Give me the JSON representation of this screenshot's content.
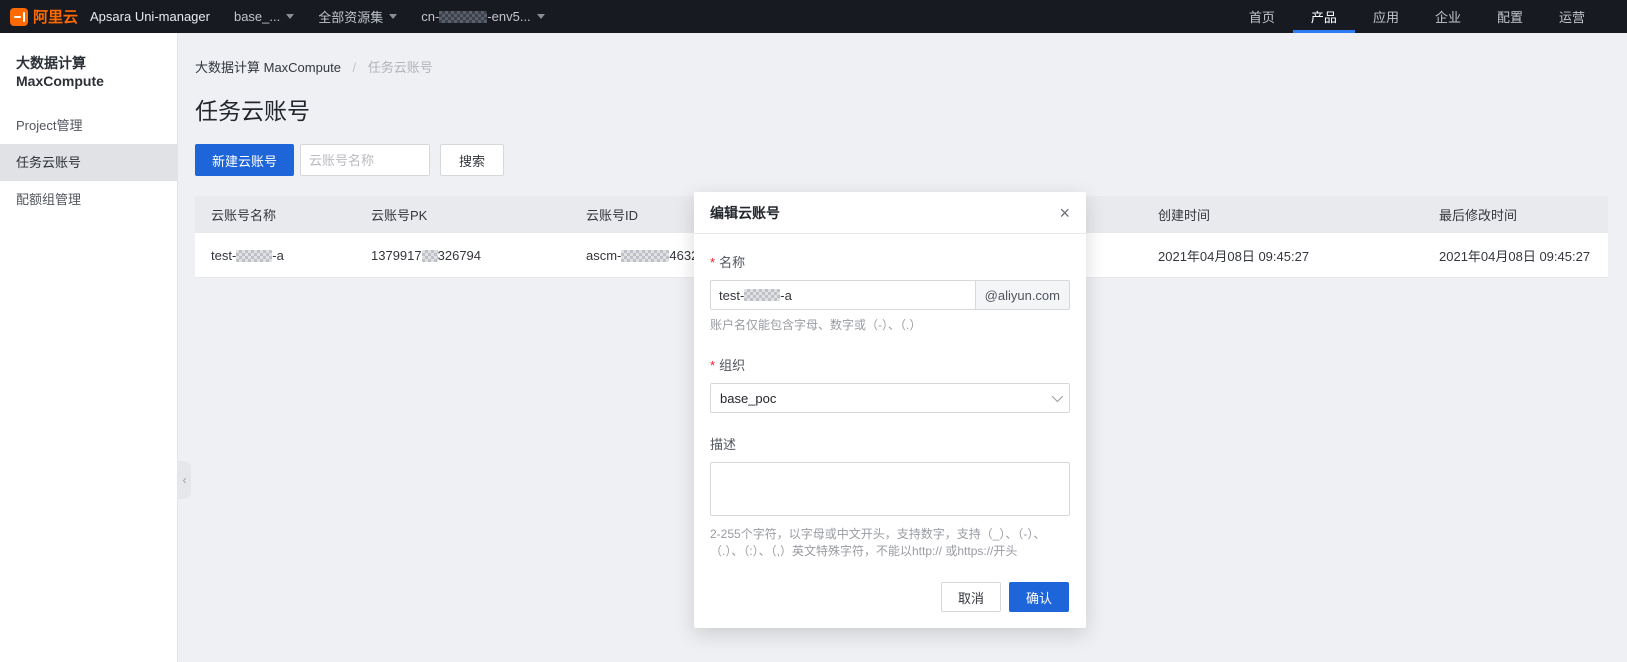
{
  "topbar": {
    "logo_text": "阿里云",
    "product_name": "Apsara Uni-manager",
    "org_dropdown": "base_...",
    "resource_dropdown": "全部资源集",
    "region_prefix": "cn-",
    "region_suffix": "-env5...",
    "menu": [
      {
        "label": "首页"
      },
      {
        "label": "产品"
      },
      {
        "label": "应用"
      },
      {
        "label": "企业"
      },
      {
        "label": "配置"
      },
      {
        "label": "运营"
      }
    ]
  },
  "sidebar": {
    "title": "大数据计算 MaxCompute",
    "items": [
      {
        "label": "Project管理"
      },
      {
        "label": "任务云账号"
      },
      {
        "label": "配额组管理"
      }
    ]
  },
  "breadcrumb": {
    "root": "大数据计算 MaxCompute",
    "separator": "/",
    "current": "任务云账号"
  },
  "page": {
    "title": "任务云账号",
    "new_button": "新建云账号",
    "search_placeholder": "云账号名称",
    "search_button": "搜索"
  },
  "table": {
    "headers": [
      "云账号名称",
      "云账号PK",
      "云账号ID",
      "创建时间",
      "最后修改时间"
    ],
    "row": {
      "name_prefix": "test-",
      "name_suffix": "-a",
      "pk_prefix": "1379917",
      "pk_suffix": "326794",
      "id_prefix": "ascm-",
      "id_mid": "4632",
      "created": "2021年04月08日 09:45:27",
      "modified": "2021年04月08日 09:45:27"
    }
  },
  "modal": {
    "title": "编辑云账号",
    "required_mark": "*",
    "name_label": "名称",
    "name_value_prefix": "test-",
    "name_value_suffix": "-a",
    "name_addon": "@aliyun.com",
    "name_help": "账户名仅能包含字母、数字或（-）、（.）",
    "org_label": "组织",
    "org_value": "base_poc",
    "desc_label": "描述",
    "desc_help": "2-255个字符，以字母或中文开头，支持数字，支持（_）、（-）、（.）、（:）、（,）英文特殊字符，不能以http:// 或https://开头",
    "cancel_button": "取消",
    "confirm_button": "确认"
  },
  "icons": {
    "close": "×",
    "collapse": "‹"
  },
  "colors": {
    "accent": "#1d65d8",
    "logo_orange": "#ff6a00",
    "required_red": "#f5222d",
    "topbar_bg": "#171a20"
  }
}
